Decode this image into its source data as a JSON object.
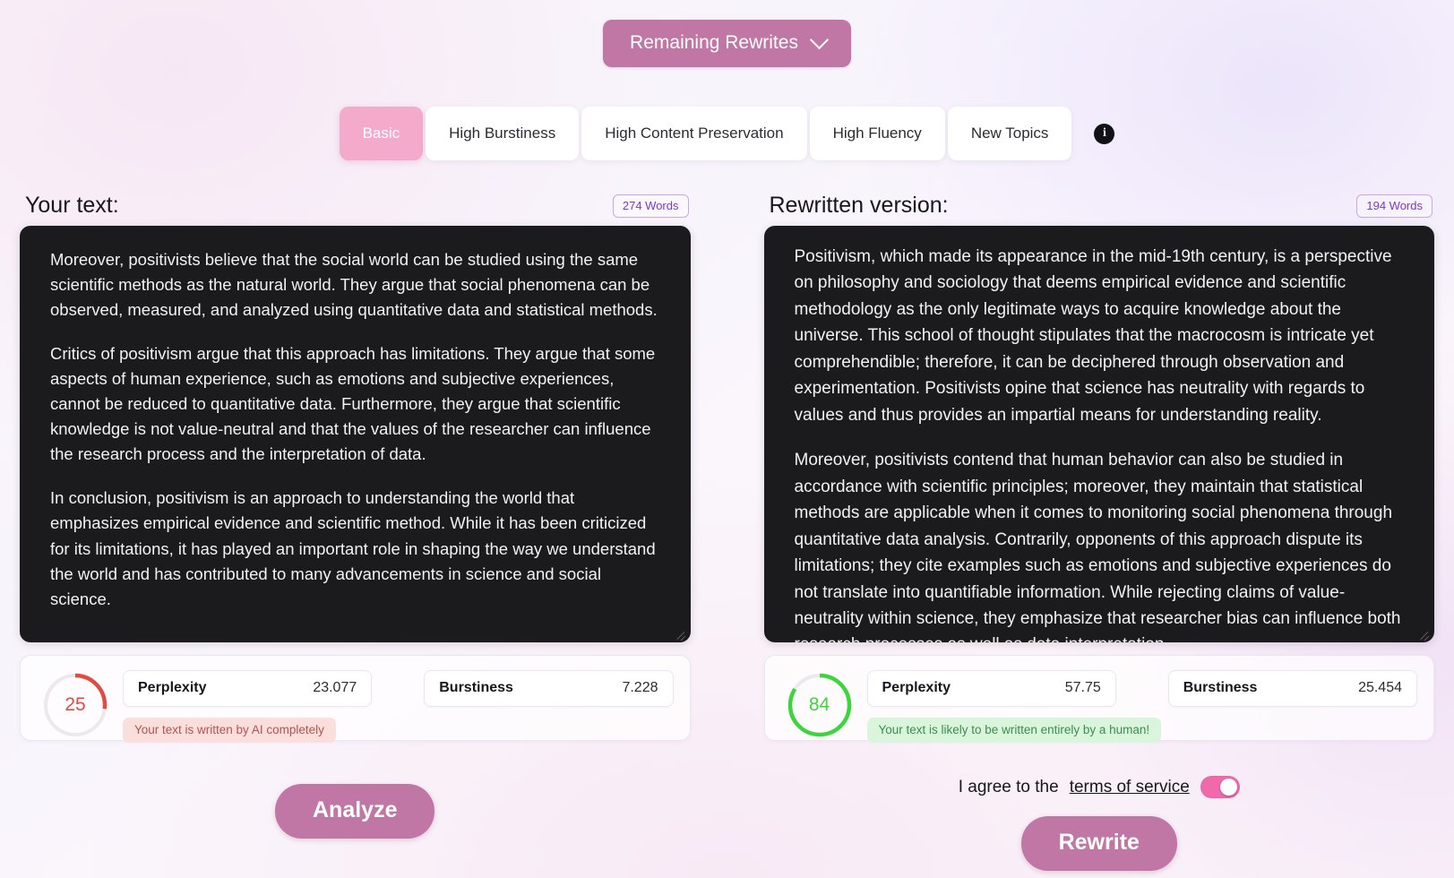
{
  "header": {
    "dropdown_label": "Remaining Rewrites",
    "chevron_icon": "chevron-down-icon"
  },
  "tabs": {
    "items": [
      {
        "label": "Basic",
        "active": true
      },
      {
        "label": "High Burstiness",
        "active": false
      },
      {
        "label": "High Content Preservation",
        "active": false
      },
      {
        "label": "High Fluency",
        "active": false
      },
      {
        "label": "New Topics",
        "active": false
      }
    ],
    "info_icon": "info-icon",
    "info_glyph": "i"
  },
  "left_panel": {
    "title": "Your text:",
    "word_badge": "274 Words",
    "paragraphs": [
      "Moreover, positivists believe that the social world can be studied using the same scientific methods as the natural world. They argue that social phenomena can be observed, measured, and analyzed using quantitative data and statistical methods.",
      "Critics of positivism argue that this approach has limitations. They argue that some aspects of human experience, such as emotions and subjective experiences, cannot be reduced to quantitative data. Furthermore, they argue that scientific knowledge is not value-neutral and that the values of the researcher can influence the research process and the interpretation of data.",
      "In conclusion, positivism is an approach to understanding the world that emphasizes empirical evidence and scientific method. While it has been criticized for its limitations, it has played an important role in shaping the way we understand the world and has contributed to many advancements in science and social science."
    ],
    "metrics": {
      "score": "25",
      "score_percent": 27,
      "score_color": "#e04b42",
      "perplexity_label": "Perplexity",
      "perplexity_value": "23.077",
      "burstiness_label": "Burstiness",
      "burstiness_value": "7.228",
      "verdict": "Your text is written by AI completely"
    }
  },
  "right_panel": {
    "title": "Rewritten version:",
    "word_badge": "194 Words",
    "paragraphs": [
      "Positivism, which made its appearance in the mid-19th century, is a perspective on philosophy and sociology that deems empirical evidence and scientific methodology as the only legitimate ways to acquire knowledge about the universe. This school of thought stipulates that the macrocosm is intricate yet comprehendible; therefore, it can be deciphered through observation and experimentation. Positivists opine that science has neutrality with regards to values and thus provides an impartial means for understanding reality.",
      "Moreover, positivists contend that human behavior can also be studied in accordance with scientific principles; moreover, they maintain that statistical methods are applicable when it comes to monitoring social phenomena through quantitative data analysis. Contrarily, opponents of this approach dispute its limitations; they cite examples such as emotions and subjective experiences do not translate into quantifiable information. While rejecting claims of value-neutrality within science, they emphasize that researcher bias can influence both research processes as well as data interpretation."
    ],
    "metrics": {
      "score": "84",
      "score_percent": 84,
      "score_color": "#3ed43e",
      "perplexity_label": "Perplexity",
      "perplexity_value": "57.75",
      "burstiness_label": "Burstiness",
      "burstiness_value": "25.454",
      "verdict": "Your text is likely to be written entirely by a human!"
    }
  },
  "footer": {
    "analyze_label": "Analyze",
    "rewrite_label": "Rewrite",
    "tos_prefix": "I agree to the",
    "tos_link": "terms of service",
    "toggle_on": true
  },
  "colors": {
    "accent_mauve": "#c177a5",
    "accent_pink": "#f3aacb",
    "toggle_pink": "#ef69ab",
    "badge_purple": "#7b39c6",
    "editor_bg": "#1b1b1d"
  }
}
